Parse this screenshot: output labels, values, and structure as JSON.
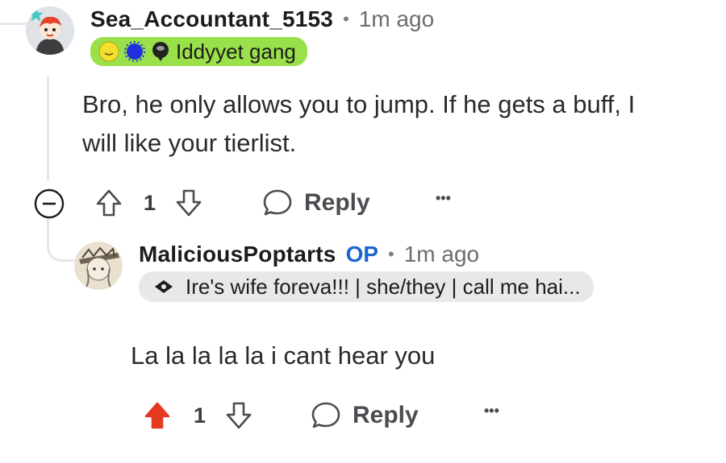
{
  "comments": [
    {
      "username": "Sea_Accountant_5153",
      "separator": "•",
      "time": "1m ago",
      "flair": {
        "text": "Iddyyet gang",
        "bg": "#9ae04a",
        "emojis": [
          "sun-emoji",
          "blue-splat-emoji",
          "alien-emoji"
        ]
      },
      "body": "Bro, he only allows you to jump. If he gets a buff, I will like your tierlist.",
      "votes": "1",
      "reply_label": "Reply",
      "more": "•••",
      "upvoted": false
    },
    {
      "username": "MaliciousPoptarts",
      "op_label": "OP",
      "separator": "•",
      "time": "1m ago",
      "flair": {
        "text": "Ire's wife foreva!!! | she/they | call me hai...",
        "bg": "#e6e8ea",
        "emojis": [
          "eye-emoji"
        ]
      },
      "body": "La la la la la i cant hear you",
      "votes": "1",
      "reply_label": "Reply",
      "more": "•••",
      "upvoted": true
    }
  ],
  "colors": {
    "upvote_active": "#e5391f",
    "op": "#1a66d2",
    "icon": "#4a4d50"
  }
}
